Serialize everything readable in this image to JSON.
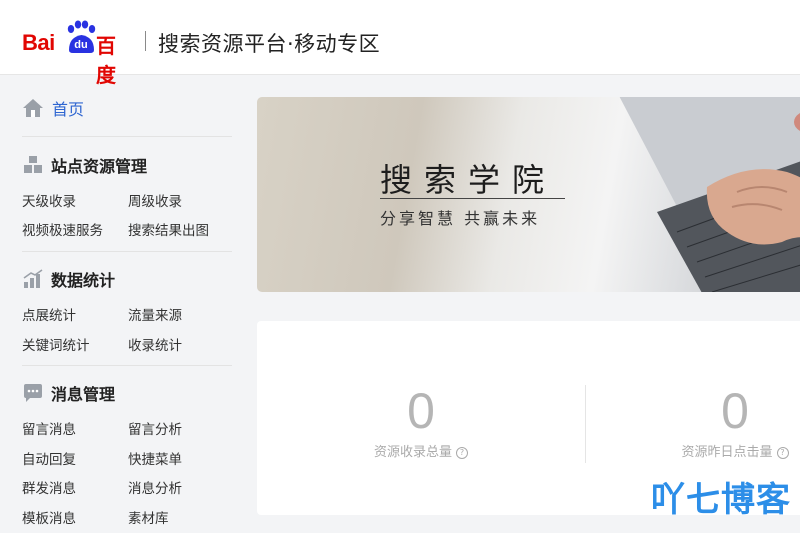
{
  "header": {
    "logo_bai": "Bai",
    "logo_du": "du",
    "logo_baidu_cn": "百度",
    "title": "搜索资源平台·移动专区"
  },
  "sidebar": {
    "home_label": "首页",
    "sections": [
      {
        "title": "站点资源管理",
        "icon": "cubes-icon",
        "links": [
          "天级收录",
          "周级收录",
          "视频极速服务",
          "搜索结果出图"
        ]
      },
      {
        "title": "数据统计",
        "icon": "bar-chart-icon",
        "links": [
          "点展统计",
          "流量来源",
          "关键词统计",
          "收录统计"
        ]
      },
      {
        "title": "消息管理",
        "icon": "chat-bubble-icon",
        "links": [
          "留言消息",
          "留言分析",
          "自动回复",
          "快捷菜单",
          "群发消息",
          "消息分析",
          "模板消息",
          "素材库"
        ]
      }
    ]
  },
  "banner": {
    "title": "搜索学院",
    "subtitle": "分享智慧 共赢未来"
  },
  "stats": [
    {
      "value": "0",
      "label": "资源收录总量"
    },
    {
      "value": "0",
      "label": "资源昨日点击量"
    }
  ],
  "watermark": "吖七博客",
  "colors": {
    "brand_red": "#e10602",
    "brand_blue": "#2932e1",
    "link_blue": "#2f66d1",
    "watermark_blue": "#2c8ee8"
  }
}
